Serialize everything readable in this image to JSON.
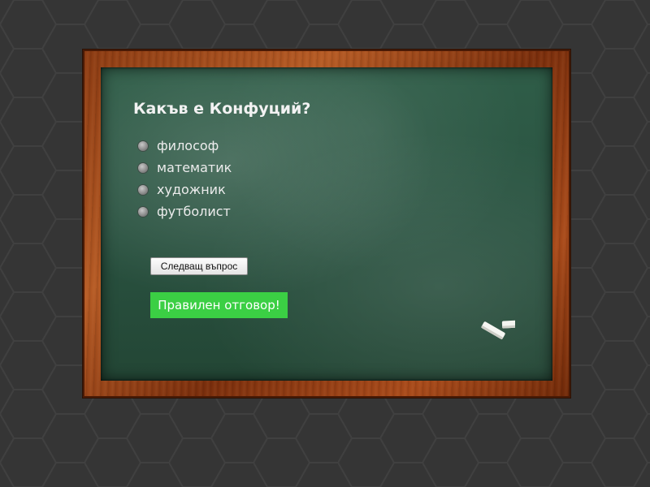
{
  "quiz": {
    "question": "Какъв е Конфуций?",
    "answers": [
      {
        "label": "философ"
      },
      {
        "label": "математик"
      },
      {
        "label": "художник"
      },
      {
        "label": "футболист"
      }
    ],
    "next_button_label": "Следващ въпрос",
    "result_text": "Правилен отговор!"
  },
  "colors": {
    "background": "#353535",
    "board": "#2a5341",
    "frame": "#8a3a12",
    "result_banner": "#3bcf44"
  },
  "icons": {
    "chalk": "chalk-pieces-icon",
    "radio": "radio-icon"
  }
}
